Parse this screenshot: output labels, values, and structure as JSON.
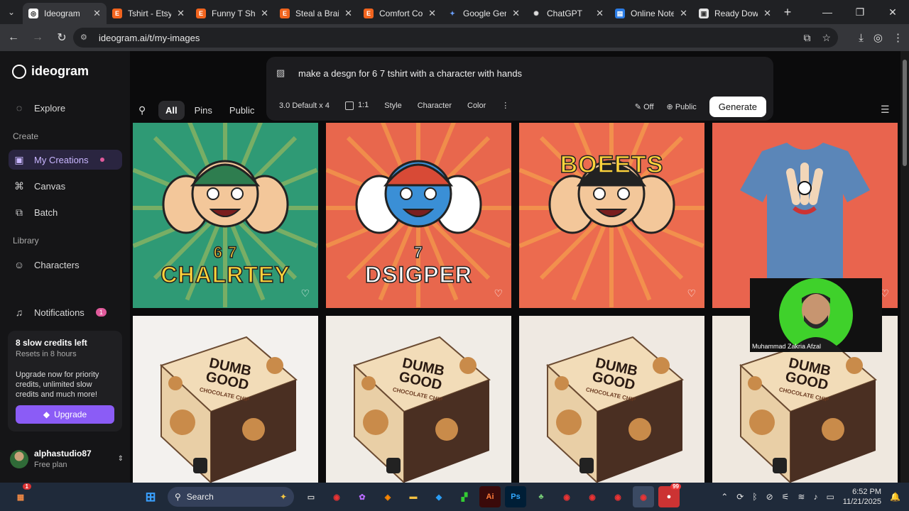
{
  "browser": {
    "tabs": [
      {
        "title": "Ideogram",
        "favicon": "ideogram-icon",
        "active": true
      },
      {
        "title": "Tshirt - Etsy S",
        "favicon": "etsy-icon"
      },
      {
        "title": "Funny T Shirt",
        "favicon": "etsy-icon"
      },
      {
        "title": "Steal a Brainr",
        "favicon": "etsy-icon"
      },
      {
        "title": "Comfort Colo",
        "favicon": "etsy-icon"
      },
      {
        "title": "Google Gemi",
        "favicon": "gemini-icon"
      },
      {
        "title": "ChatGPT",
        "favicon": "chatgpt-icon"
      },
      {
        "title": "Online Notep",
        "favicon": "notepad-icon"
      },
      {
        "title": "Ready Down",
        "favicon": "download-icon"
      }
    ],
    "url": "ideogram.ai/t/my-images"
  },
  "sidebar": {
    "logo_text": "ideogram",
    "explore": "Explore",
    "create_section": "Create",
    "my_creations": "My Creations",
    "canvas": "Canvas",
    "batch": "Batch",
    "library_section": "Library",
    "characters": "Characters",
    "notifications": "Notifications",
    "notifications_count": "1",
    "credits_title": "8 slow credits left",
    "credits_sub": "Resets in 8 hours",
    "credits_desc": "Upgrade now for priority credits, unlimited slow credits and much more!",
    "upgrade": "Upgrade",
    "user_name": "alphastudio87",
    "user_plan": "Free plan"
  },
  "filters": {
    "all": "All",
    "pins": "Pins",
    "public": "Public"
  },
  "prompt": {
    "text": "make a desgn for 6 7 tshirt with a character with hands",
    "model": "3.0 Default x 4",
    "ratio": "1:1",
    "style": "Style",
    "character": "Character",
    "color": "Color",
    "magic": "Off",
    "visibility": "Public",
    "generate": "Generate"
  },
  "images": [
    {
      "title": "CHALRTEY",
      "sub": "6 7",
      "bg": "#2f9a75"
    },
    {
      "title": "DSIGPER",
      "sub": "7",
      "bg": "#e8674d"
    },
    {
      "title": "BOEETS",
      "sub": "",
      "bg": "#ec6b4f"
    },
    {
      "title": "",
      "sub": "",
      "bg": "#e9644e"
    },
    {
      "title": "DUMB GOOD",
      "sub": "CHOCOLATE CHIP",
      "bg": "#f3f1ee"
    },
    {
      "title": "DUMB GOOD",
      "sub": "CHOCOLATE CHIP",
      "bg": "#f0ece6"
    },
    {
      "title": "DUMB GOOD",
      "sub": "CHOCOLATE CHIP",
      "bg": "#efe9e2"
    },
    {
      "title": "DUMB GOOD",
      "sub": "CHOCOLATE CHIP",
      "bg": "#efe8df"
    }
  ],
  "webcam_label": "Muhammad Zakria Afzal",
  "taskbar": {
    "search": "Search",
    "time": "6:52 PM",
    "date": "11/21/2025",
    "badge": "99",
    "notif_badge": "1"
  }
}
